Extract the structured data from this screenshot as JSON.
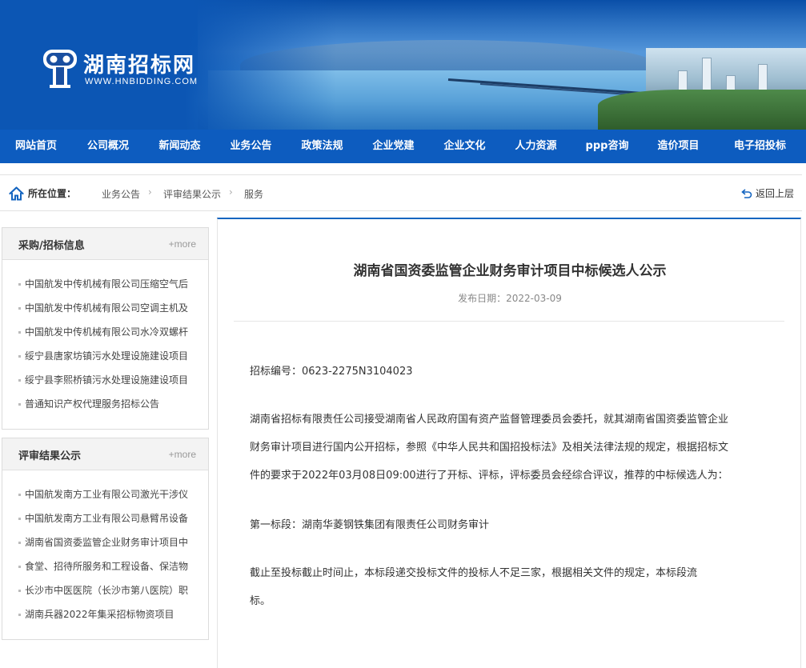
{
  "header": {
    "site_title": "湖南招标网",
    "site_url": "WWW.HNBIDDING.COM",
    "brand_color": "#0d5cbf"
  },
  "nav": {
    "items": [
      "网站首页",
      "公司概况",
      "新闻动态",
      "业务公告",
      "政策法规",
      "企业党建",
      "企业文化",
      "人力资源",
      "ppp咨询",
      "造价项目",
      "电子招投标"
    ]
  },
  "breadcrumb": {
    "label": "所在位置：",
    "items": [
      "业务公告",
      "评审结果公示",
      "服务"
    ],
    "back": "返回上层"
  },
  "sidebar": {
    "panels": [
      {
        "title": "采购/招标信息",
        "more": "+more",
        "items": [
          "中国航发中传机械有限公司压缩空气后",
          "中国航发中传机械有限公司空调主机及",
          "中国航发中传机械有限公司水冷双螺杆",
          "绥宁县唐家坊镇污水处理设施建设项目",
          "绥宁县李熙桥镇污水处理设施建设项目",
          "普通知识产权代理服务招标公告"
        ]
      },
      {
        "title": "评审结果公示",
        "more": "+more",
        "items": [
          "中国航发南方工业有限公司激光干涉仪",
          "中国航发南方工业有限公司悬臂吊设备",
          "湖南省国资委监管企业财务审计项目中",
          "食堂、招待所服务和工程设备、保洁物",
          "长沙市中医医院（长沙市第八医院）职",
          "湖南兵器2022年集采招标物资项目"
        ]
      }
    ]
  },
  "article": {
    "title": "湖南省国资委监管企业财务审计项目中标候选人公示",
    "date": "发布日期：2022-03-09",
    "bid_no": "招标编号：0623-2275N3104023",
    "para1_l1": "湖南省招标有限责任公司接受湖南省人民政府国有资产监督管理委员会委托，就其湖南省国资委监管企业",
    "para1_l2": "财务审计项目进行国内公开招标，参照《中华人民共和国招投标法》及相关法律法规的规定，根据招标文",
    "para1_l3": "件的要求于2022年03月08日09:00进行了开标、评标，评标委员会经综合评议，推荐的中标候选人为：",
    "lot1": "第一标段：湖南华菱钢铁集团有限责任公司财务审计",
    "para2_l1": "截止至投标截止时间止，本标段递交投标文件的投标人不足三家，根据相关文件的规定，本标段流",
    "para2_l2": "标。"
  }
}
